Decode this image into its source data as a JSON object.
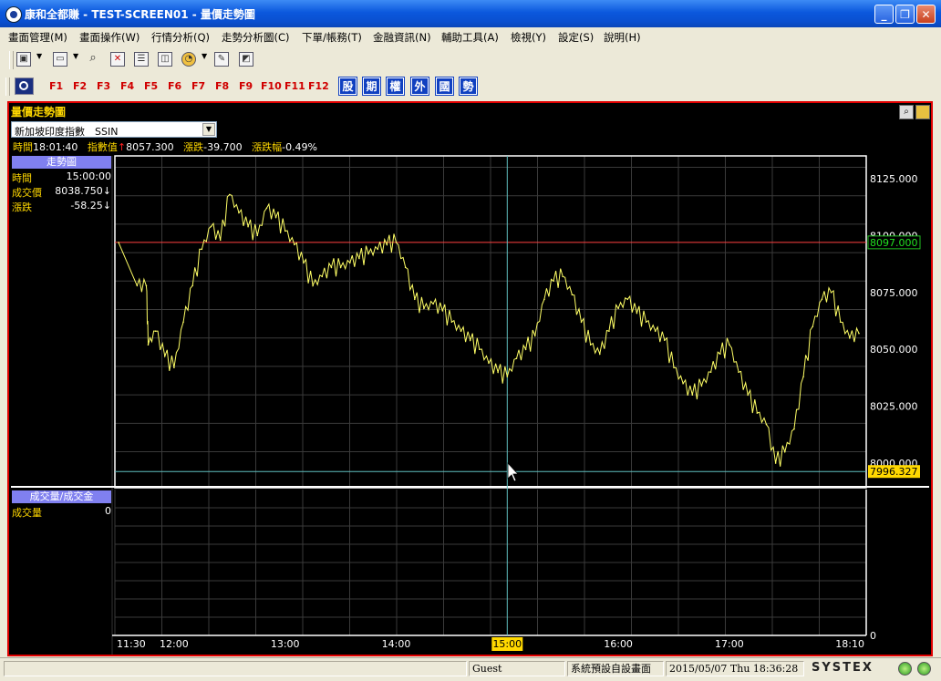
{
  "window": {
    "title": "康和全都賺 - TEST-SCREEN01 - 量價走勢圖",
    "minimize": "_",
    "maximize": "❐",
    "close": "✕"
  },
  "menu": [
    "畫面管理(M)",
    "畫面操作(W)",
    "行情分析(Q)",
    "走勢分析圖(C)",
    "下單/帳務(T)",
    "金融資訊(N)",
    "輔助工具(A)",
    "檢視(Y)",
    "設定(S)",
    "說明(H)"
  ],
  "toolbar": {
    "fkeys": [
      "F1",
      "F2",
      "F3",
      "F4",
      "F5",
      "F6",
      "F7",
      "F8",
      "F9",
      "F10",
      "F11",
      "F12"
    ],
    "quick": [
      "股",
      "期",
      "權",
      "外",
      "國",
      "勢"
    ]
  },
  "panel": {
    "title": "量價走勢圖",
    "symbol": "新加坡印度指數　SSIN",
    "quote": {
      "time_label": "時間",
      "time": "18:01:40",
      "index_label": "指數值",
      "index_arrow": "↑",
      "index": "8057.300",
      "change_label": "漲跌",
      "change": "-39.700",
      "pct_label": "漲跌幅",
      "pct": "-0.49%"
    },
    "trend_header": "走勢圖",
    "cursor_info": {
      "time_label": "時間",
      "time": "15:00:00",
      "price_label": "成交價",
      "price": "8038.750↓",
      "change_label": "漲跌",
      "change": "-58.25↓"
    },
    "volume_header": "成交量/成交金",
    "volume_label": "成交量",
    "volume_value": "0"
  },
  "chart_data": {
    "type": "line",
    "x_ticks": [
      "11:30",
      "12:00",
      "13:00",
      "14:00",
      "15:00",
      "16:00",
      "17:00",
      "18:10"
    ],
    "highlighted_x": "15:00",
    "y_ticks": [
      "8125.000",
      "8100.000",
      "8075.000",
      "8050.000",
      "8025.000",
      "8000.000"
    ],
    "ylim": [
      7990,
      8135
    ],
    "reference_line": {
      "label": "8097.000",
      "value": 8097,
      "color": "#ff4040"
    },
    "cursor_line": {
      "label": "7996.327",
      "value": 7996.327
    },
    "volume_axis_label": "0",
    "series": [
      {
        "color": "#ffff66",
        "x": [
          "11:30",
          "11:40",
          "11:45",
          "11:46",
          "11:50",
          "11:55",
          "12:00",
          "12:05",
          "12:10",
          "12:15",
          "12:20",
          "12:25",
          "12:30",
          "12:35",
          "12:40",
          "12:45",
          "12:50",
          "12:55",
          "13:00",
          "13:05",
          "13:10",
          "13:15",
          "13:20",
          "13:25",
          "13:30",
          "13:35",
          "13:40",
          "13:45",
          "13:50",
          "13:55",
          "14:00",
          "14:05",
          "14:10",
          "14:15",
          "14:20",
          "14:25",
          "14:30",
          "14:35",
          "14:40",
          "14:45",
          "14:50",
          "14:55",
          "15:00",
          "15:05",
          "15:10",
          "15:15",
          "15:20",
          "15:25",
          "15:30",
          "15:35",
          "15:40",
          "15:45",
          "15:50",
          "15:55",
          "16:00",
          "16:05",
          "16:10",
          "16:15",
          "16:20",
          "16:25",
          "16:30",
          "16:35",
          "16:40",
          "16:45",
          "16:50",
          "16:55",
          "17:00",
          "17:05",
          "17:10",
          "17:15",
          "17:20",
          "17:25",
          "17:30",
          "17:35",
          "17:40",
          "17:45",
          "17:50",
          "17:55",
          "18:00",
          "18:05",
          "18:10"
        ],
        "values": [
          8097,
          8078,
          8078,
          8052,
          8058,
          8047,
          8042,
          8062,
          8078,
          8094,
          8104,
          8098,
          8118,
          8110,
          8104,
          8100,
          8112,
          8108,
          8102,
          8096,
          8088,
          8078,
          8082,
          8086,
          8086,
          8088,
          8090,
          8092,
          8094,
          8096,
          8097,
          8086,
          8072,
          8068,
          8070,
          8067,
          8062,
          8058,
          8054,
          8050,
          8044,
          8040,
          8038,
          8046,
          8050,
          8056,
          8072,
          8080,
          8082,
          8074,
          8062,
          8052,
          8048,
          8058,
          8068,
          8072,
          8066,
          8062,
          8058,
          8054,
          8042,
          8035,
          8030,
          8034,
          8040,
          8048,
          8052,
          8040,
          8030,
          8022,
          8017,
          8000,
          8005,
          8015,
          8038,
          8060,
          8072,
          8075,
          8062,
          8055,
          8057
        ]
      }
    ]
  }
}
